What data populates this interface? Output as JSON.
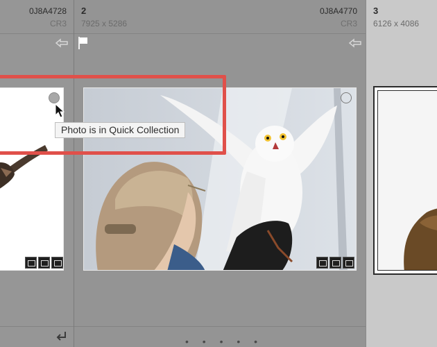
{
  "grid": {
    "cells": [
      {
        "index": "",
        "dims": "",
        "filename": "0J8A4728",
        "ext": "CR3"
      },
      {
        "index": "2",
        "dims": "7925 x 5286",
        "filename": "0J8A4770",
        "ext": "CR3"
      },
      {
        "index": "3",
        "dims": "6126 x 4086",
        "filename": "",
        "ext": ""
      }
    ],
    "pagination_dots": "• • • • •"
  },
  "tooltip": {
    "text": "Photo is in Quick Collection"
  },
  "colors": {
    "callout": "#e0504a",
    "grid_bg": "#949494",
    "selected_cell_bg": "#c9c9c9"
  }
}
